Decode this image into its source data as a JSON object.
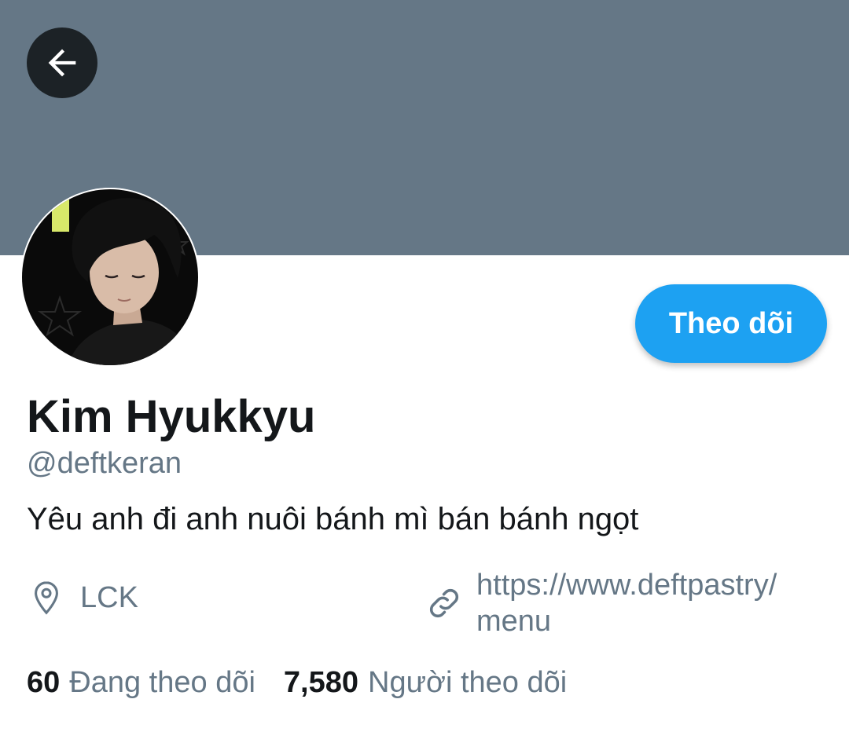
{
  "header": {
    "banner_color": "#657786",
    "back_icon": "arrow-left-icon"
  },
  "profile": {
    "display_name": "Kim Hyukkyu",
    "handle": "@deftkeran",
    "bio": "Yêu anh đi anh nuôi bánh mì bán bánh ngọt",
    "location": "LCK",
    "location_icon": "location-pin-icon",
    "website_line1": "https://www.deftpastry/",
    "website_line2": "menu",
    "website_icon": "link-icon"
  },
  "actions": {
    "follow_label": "Theo dõi",
    "accent_color": "#1da1f2"
  },
  "stats": {
    "following_count": "60",
    "following_label": "Đang theo dõi",
    "followers_count": "7,580",
    "followers_label": "Người theo dõi"
  }
}
